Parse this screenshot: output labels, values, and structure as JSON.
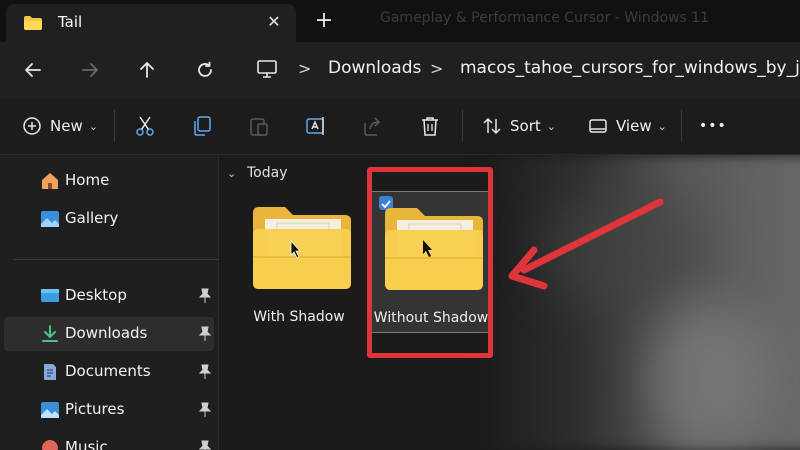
{
  "colors": {
    "accent_red": "#e0343b",
    "folder_yellow": "#f6c744",
    "selection_blue": "#3b82d6"
  },
  "tabbar": {
    "tab_title": "Tail",
    "close_symbol": "✕",
    "add_symbol": "+",
    "background_title": "Gameplay & Performance Cursor - Windows 11"
  },
  "navigation": {
    "icons": [
      "back-arrow-icon",
      "forward-arrow-icon",
      "up-arrow-icon",
      "refresh-icon"
    ],
    "breadcrumb": [
      "Downloads",
      "macos_tahoe_cursors_for_windows_by_jimmyx"
    ],
    "separator": ">"
  },
  "commandbar": {
    "new_label": "New",
    "sort_label": "Sort",
    "view_label": "View",
    "more_symbol": "•••",
    "chevron": "⌄"
  },
  "sidebar": {
    "items": [
      {
        "label": "Home",
        "icon": "home-icon",
        "pinned": false
      },
      {
        "label": "Gallery",
        "icon": "gallery-icon",
        "pinned": false
      },
      {
        "label": "Desktop",
        "icon": "desktop-icon",
        "pinned": true
      },
      {
        "label": "Downloads",
        "icon": "download-icon",
        "pinned": true,
        "selected": true
      },
      {
        "label": "Documents",
        "icon": "document-icon",
        "pinned": true
      },
      {
        "label": "Pictures",
        "icon": "pictures-icon",
        "pinned": true
      },
      {
        "label": "Music",
        "icon": "music-icon",
        "pinned": true
      }
    ]
  },
  "content": {
    "group_label": "Today",
    "group_chevron": "⌄",
    "folders": [
      {
        "label": "With Shadow",
        "selected": false
      },
      {
        "label": "Without Shadow",
        "selected": true,
        "checked": true
      }
    ]
  }
}
